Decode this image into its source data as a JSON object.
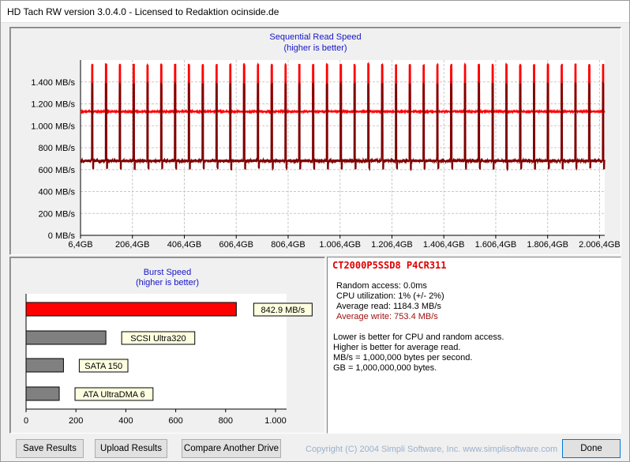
{
  "window": {
    "title": "HD Tach RW version 3.0.4.0 - Licensed to Redaktion ocinside.de"
  },
  "sequential": {
    "title": "Sequential Read Speed",
    "subtitle": "(higher is better)"
  },
  "burst": {
    "title": "Burst Speed",
    "subtitle": "(higher is better)"
  },
  "info": {
    "drive": "CT2000P5SSD8 P4CR311",
    "random_access": "Random access: 0.0ms",
    "cpu": "CPU utilization: 1% (+/- 2%)",
    "avg_read": "Average read: 1184.3 MB/s",
    "avg_write": "Average write: 753.4 MB/s",
    "note1": "Lower is better for CPU and random access.",
    "note2": "Higher is better for average read.",
    "note3": "MB/s = 1,000,000 bytes per second.",
    "note4": "GB = 1,000,000,000 bytes."
  },
  "buttons": {
    "save": "Save Results",
    "upload": "Upload Results",
    "compare": "Compare Another Drive",
    "done": "Done"
  },
  "copyright": "Copyright (C) 2004 Simpli Software, Inc. www.simplisoftware.com",
  "colors": {
    "read": "#ff0000",
    "write": "#800000",
    "title_blue": "#1515c8",
    "bar_gray": "#808080"
  },
  "chart_data": [
    {
      "type": "line",
      "title": "Sequential Read Speed",
      "subtitle": "(higher is better)",
      "y_ticks": [
        "0 MB/s",
        "200 MB/s",
        "400 MB/s",
        "600 MB/s",
        "800 MB/s",
        "1.000 MB/s",
        "1.200 MB/s",
        "1.400 MB/s"
      ],
      "x_ticks": [
        "6,4GB",
        "206,4GB",
        "406,4GB",
        "606,4GB",
        "806,4GB",
        "1.006,4GB",
        "1.206,4GB",
        "1.406,4GB",
        "1.606,4GB",
        "1.806,4GB",
        "2.006,4GB"
      ],
      "ylim": [
        0,
        1600
      ],
      "xlim": [
        0,
        2020
      ],
      "grid": true,
      "series": [
        {
          "color": "#ff0000",
          "baseline": 1130,
          "peak": 1565,
          "spike_period_gb": 53.2,
          "spike_width_gb": 4.2
        },
        {
          "color": "#800000",
          "baseline": 680,
          "low": 600,
          "peak": 1390,
          "spike_period_gb": 53.2,
          "spike_width_gb": 4.2
        }
      ]
    },
    {
      "type": "bar",
      "title": "Burst Speed",
      "subtitle": "(higher is better)",
      "categories": [
        "",
        "SCSI Ultra320",
        "SATA 150",
        "ATA UltraDMA 6"
      ],
      "values": [
        842.9,
        320,
        150,
        133
      ],
      "value_labels": [
        "842.9 MB/s",
        "",
        "",
        ""
      ],
      "x_ticks": [
        "0",
        "200",
        "400",
        "600",
        "800",
        "1.000"
      ],
      "xlim": [
        0,
        1000
      ]
    }
  ]
}
